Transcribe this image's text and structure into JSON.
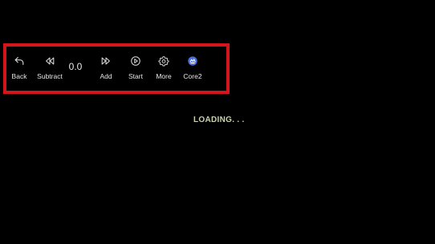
{
  "toolbar": {
    "items": [
      {
        "label": "Back",
        "icon": "back-icon"
      },
      {
        "label": "Subtract",
        "icon": "rewind-icon"
      },
      {
        "label": "Add",
        "icon": "fast-forward-icon"
      },
      {
        "label": "Start",
        "icon": "play-circle-icon"
      },
      {
        "label": "More",
        "icon": "gear-icon"
      },
      {
        "label": "Core2",
        "icon": "core2-app-icon"
      }
    ],
    "value": "0.0"
  },
  "status": {
    "loading_text": "LOADING. . .",
    "loading_color": "#c8d3a8"
  },
  "colors": {
    "background": "#000000",
    "highlight_border": "#d5141c",
    "core2_icon": "#4a6ee0"
  }
}
